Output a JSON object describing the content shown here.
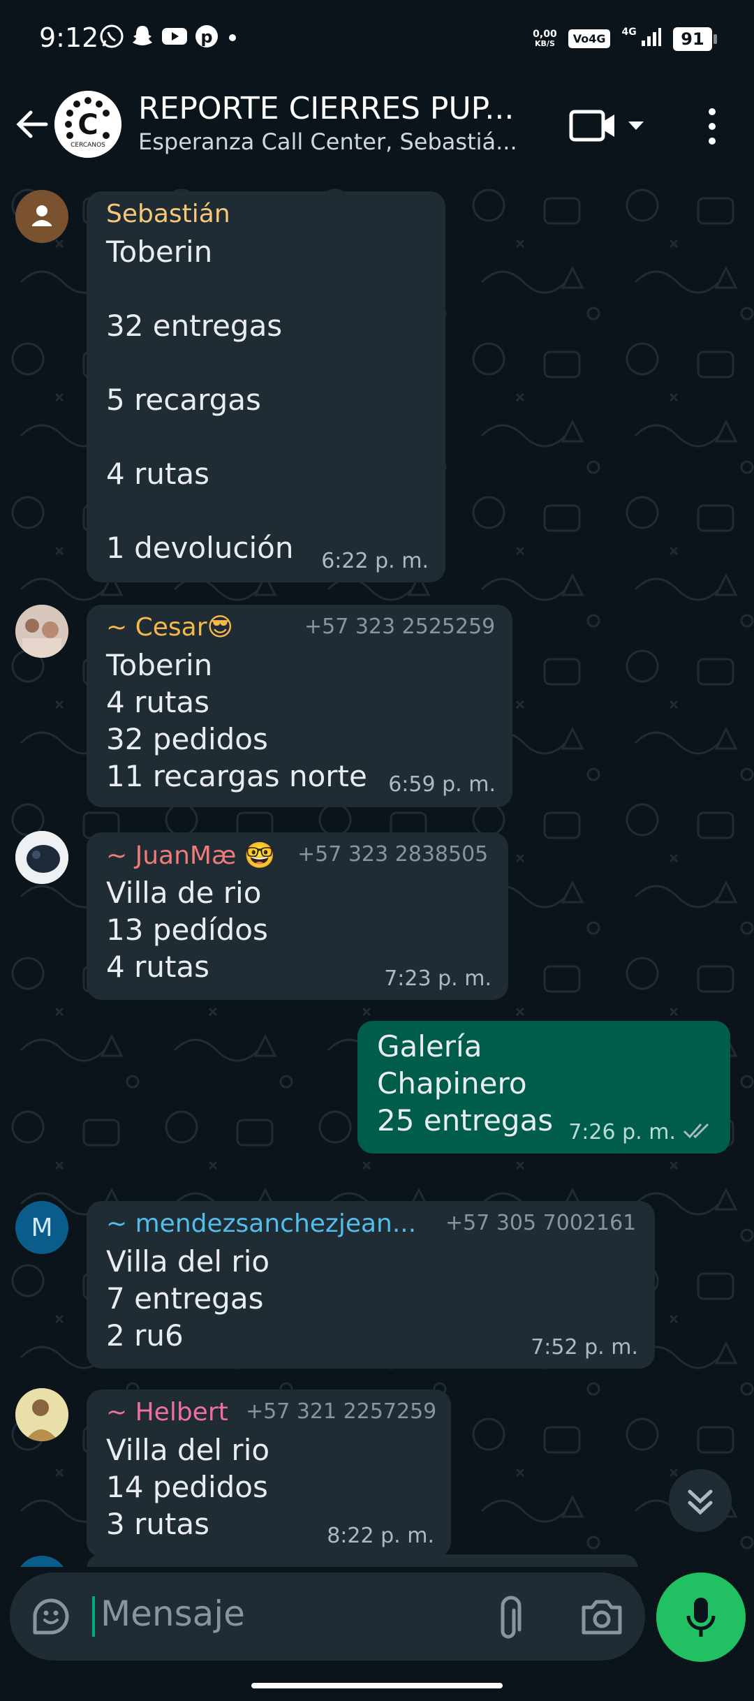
{
  "status_bar": {
    "time": "9:12",
    "net_speed_value": "0,00",
    "net_speed_unit": "KB/S",
    "volte": "Vo4G",
    "signal": "4G",
    "battery": "91",
    "icons": [
      "whatsapp-icon",
      "snapchat-icon",
      "youtube-icon",
      "pinterest-icon"
    ]
  },
  "header": {
    "title": "REPORTE CIERRES PUP...",
    "subtitle": "Esperanza Call Center, Sebastiá...",
    "avatar_text": "CERCANOS"
  },
  "colors": {
    "background": "#0b141a",
    "incoming_bubble": "#202c33",
    "outgoing_bubble": "#005c4b",
    "accent": "#21c063"
  },
  "messages": [
    {
      "sender": "Sebastián",
      "sender_color": "#f7c87a",
      "phone": "",
      "lines": [
        "Toberin",
        "",
        "32 entregas",
        "",
        "5 recargas",
        "",
        "4 rutas",
        "",
        "1 devolución"
      ],
      "time": "6:22 p. m."
    },
    {
      "sender": "~ Cesar😎",
      "sender_color": "#f6b84a",
      "phone": "+57 323 2525259",
      "lines": [
        "Toberin",
        "4 rutas",
        "32 pedidos",
        "11 recargas norte"
      ],
      "time": "6:59 p. m."
    },
    {
      "sender": "~ JuanMæ 🤓",
      "sender_color": "#f07b7b",
      "phone": "+57 323 2838505",
      "lines": [
        "Villa de rio",
        "13 pedídos",
        "4 rutas"
      ],
      "time": "7:23 p. m."
    },
    {
      "sender": "",
      "phone": "",
      "lines": [
        "Galería",
        "Chapinero",
        "25 entregas"
      ],
      "time": "7:26 p. m.",
      "outgoing": true
    },
    {
      "sender": "~ mendezsanchezjean...",
      "sender_color": "#53bdeb",
      "phone": "+57 305 7002161",
      "avatar_letter": "M",
      "lines": [
        "Villa del rio",
        "7 entregas",
        "2 ru6"
      ],
      "time": "7:52 p. m."
    },
    {
      "sender": "~ Helbert",
      "sender_color": "#ef6fa0",
      "phone": "+57 321 2257259",
      "lines": [
        "Villa del rio",
        "14 pedidos",
        "3 rutas"
      ],
      "time": "8:22 p. m."
    }
  ],
  "input": {
    "placeholder": "Mensaje"
  }
}
